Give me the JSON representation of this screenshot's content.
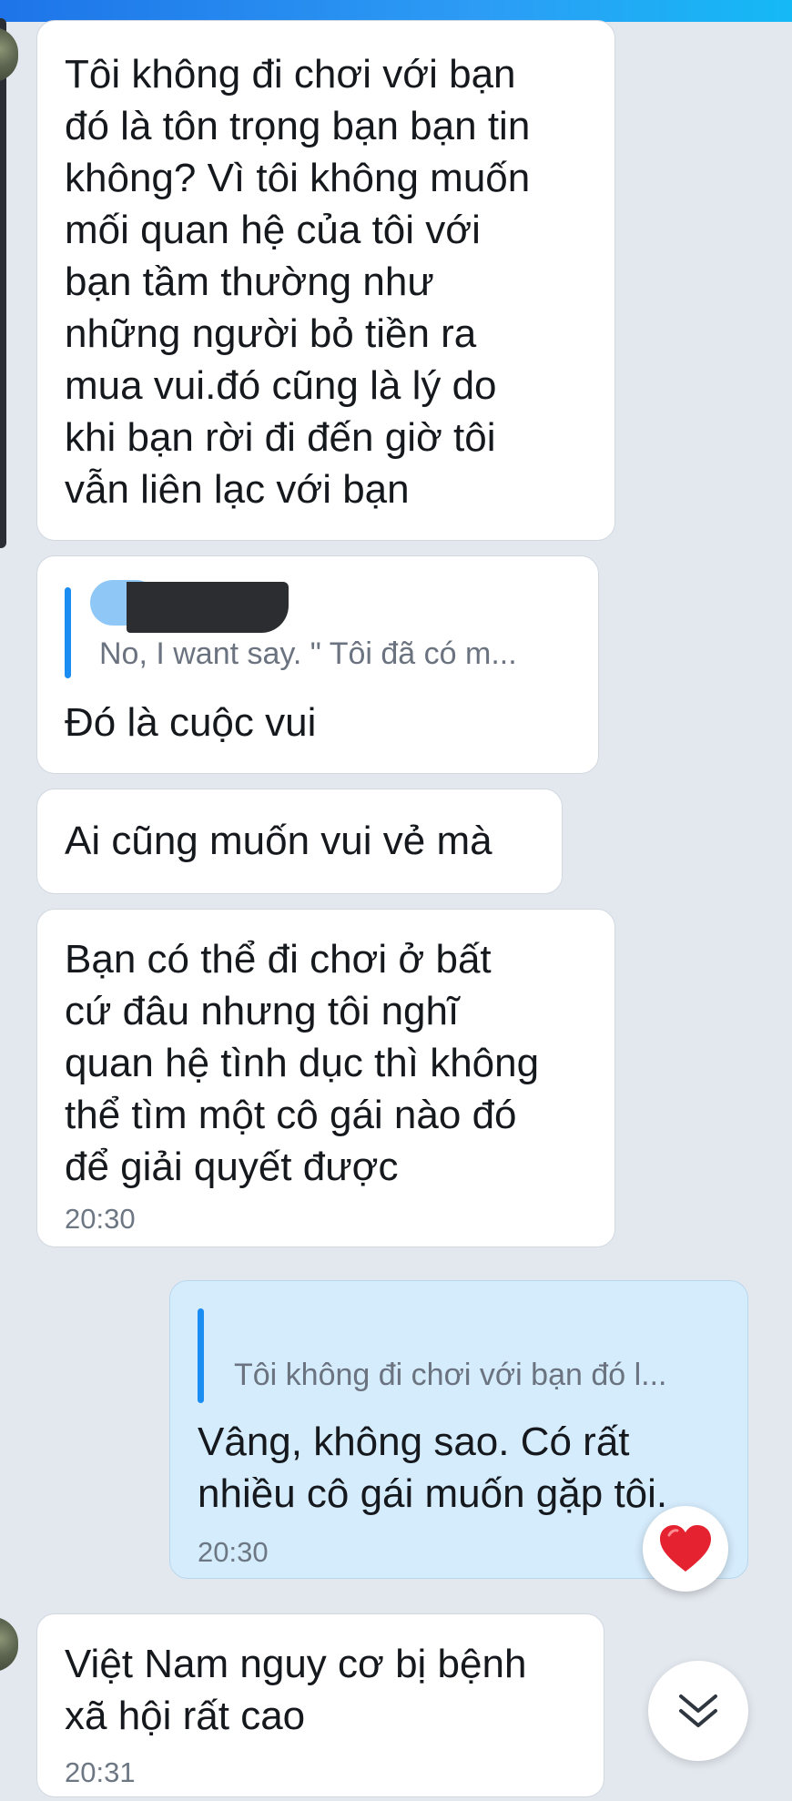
{
  "messages": [
    {
      "id": "m1",
      "text": "Tôi không đi chơi với bạn\nđó là tôn trọng bạn bạn tin\nkhông? Vì tôi không muốn\nmối quan hệ của tôi với\nbạn tầm thường như\nnhững người bỏ tiền ra\nmua vui.đó cũng là lý do\nkhi bạn rời đi đến giờ tôi\nvẫn liên lạc với bạn"
    },
    {
      "id": "m2",
      "quote": "No, I want say.  \" Tôi đã có m...",
      "text": "Đó là cuộc vui"
    },
    {
      "id": "m3",
      "text": "Ai cũng muốn vui vẻ mà"
    },
    {
      "id": "m4",
      "text": "Bạn có thể đi chơi ở bất\ncứ đâu nhưng tôi nghĩ\nquan hệ tình dục thì không\nthể tìm một cô gái nào đó\nđể giải quyết được",
      "time": "20:30"
    },
    {
      "id": "m5",
      "quote": "Tôi không đi chơi với bạn đó l...",
      "text": "Vâng, không sao. Có rất\nnhiều cô gái muốn gặp tôi.",
      "time": "20:30",
      "reaction": "heart-icon"
    },
    {
      "id": "m6",
      "text": "Việt Nam nguy cơ bị bệnh\nxã hội rất cao",
      "time": "20:31"
    }
  ],
  "colors": {
    "background": "#e3e8ef",
    "received_bubble": "#ffffff",
    "sent_bubble": "#d5ecfc",
    "accent": "#1b8df2",
    "heart": "#e5222f"
  }
}
